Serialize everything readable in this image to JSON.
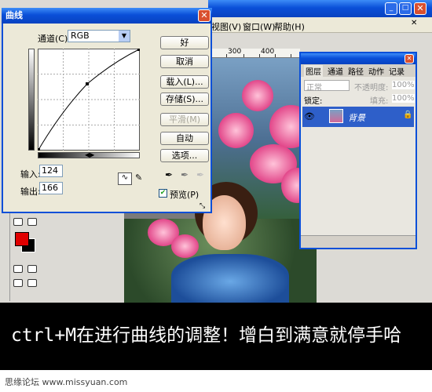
{
  "ps_window": {
    "menu": [
      "视图(V)",
      "窗口(W)",
      "帮助(H)"
    ]
  },
  "ruler": {
    "ticks": [
      "300",
      "400"
    ]
  },
  "curves_dialog": {
    "title": "曲线",
    "channel_label": "通道(C):",
    "channel_value": "RGB",
    "buttons": {
      "ok": "好",
      "cancel": "取消",
      "load": "载入(L)...",
      "save": "存储(S)...",
      "smooth": "平滑(M)",
      "auto": "自动",
      "options": "选项..."
    },
    "input_label": "输入:",
    "input_value": "124",
    "output_label": "输出:",
    "output_value": "166",
    "preview_label": "预览(P)",
    "preview_checked": true
  },
  "layers_panel": {
    "tabs": [
      "图层",
      "通道",
      "路径",
      "动作",
      "记录"
    ],
    "blend_mode": "正常",
    "opacity_label": "不透明度:",
    "opacity_value": "100%",
    "lock_label": "锁定:",
    "fill_label": "填充:",
    "fill_value": "100%",
    "layer_name": "背景"
  },
  "colors": {
    "foreground": "#e00000",
    "background": "#000000",
    "title_blue": "#0a4fd8"
  },
  "caption": "ctrl+M在进行曲线的调整！增白到满意就停手哈",
  "watermark": "思缘论坛 www.missyuan.com"
}
